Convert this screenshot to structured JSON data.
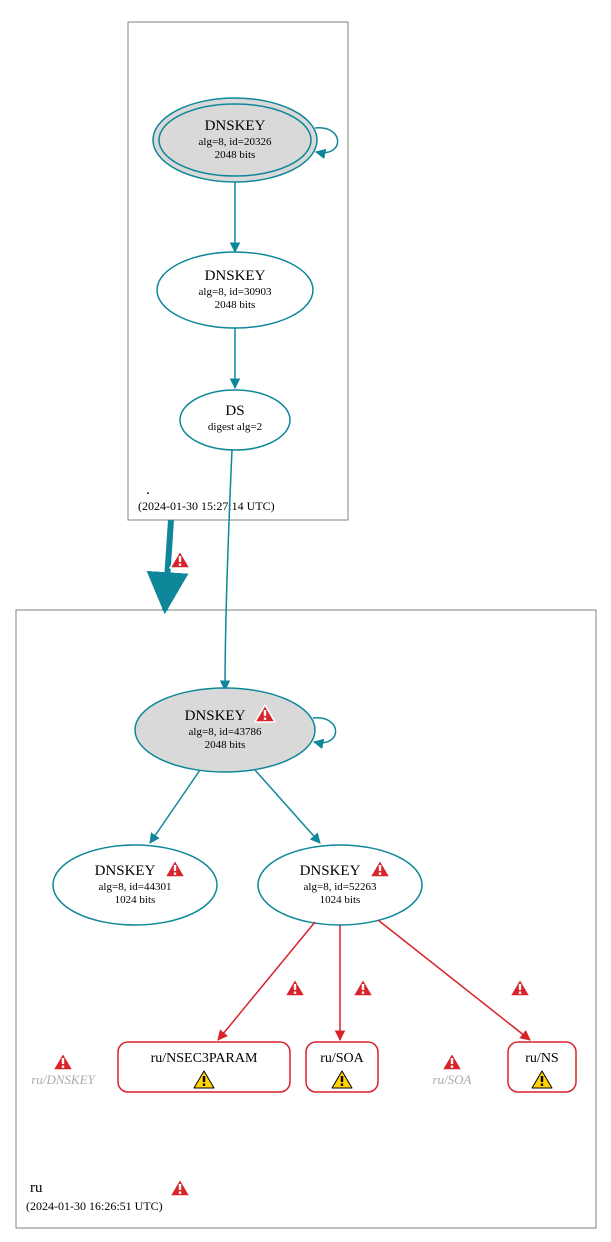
{
  "colors": {
    "teal": "#0d8799",
    "red": "#d8232a",
    "grey_fill": "#d9d9d9",
    "box_grey": "#808080"
  },
  "zones": {
    "root": {
      "label": ".",
      "timestamp": "(2024-01-30 15:27:14 UTC)"
    },
    "ru": {
      "label": "ru",
      "timestamp": "(2024-01-30 16:26:51 UTC)"
    }
  },
  "nodes": {
    "root_ksk": {
      "title": "DNSKEY",
      "line2": "alg=8, id=20326",
      "line3": "2048 bits"
    },
    "root_zsk": {
      "title": "DNSKEY",
      "line2": "alg=8, id=30903",
      "line3": "2048 bits"
    },
    "root_ds": {
      "title": "DS",
      "line2": "digest alg=2"
    },
    "ru_ksk": {
      "title": "DNSKEY",
      "line2": "alg=8, id=43786",
      "line3": "2048 bits"
    },
    "ru_zsk1": {
      "title": "DNSKEY",
      "line2": "alg=8, id=44301",
      "line3": "1024 bits"
    },
    "ru_zsk2": {
      "title": "DNSKEY",
      "line2": "alg=8, id=52263",
      "line3": "1024 bits"
    }
  },
  "rr": {
    "nsec3param": "ru/NSEC3PARAM",
    "soa": "ru/SOA",
    "ns": "ru/NS"
  },
  "faded": {
    "dnskey": "ru/DNSKEY",
    "soa": "ru/SOA"
  }
}
